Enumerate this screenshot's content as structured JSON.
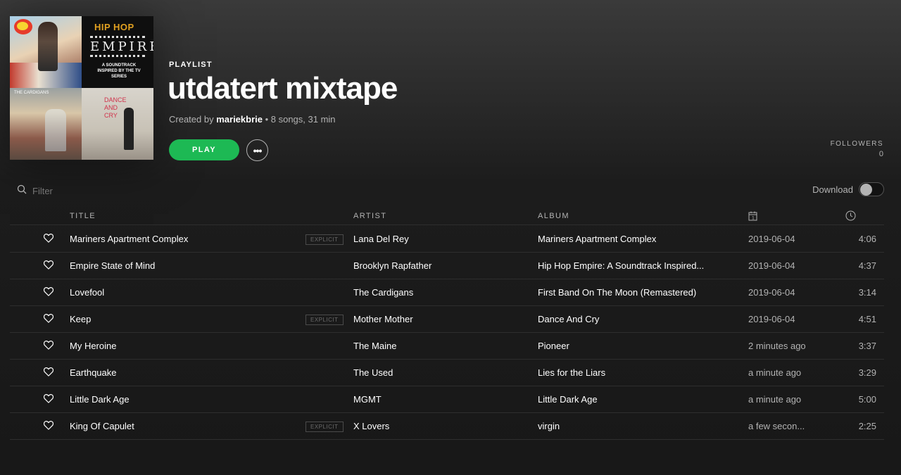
{
  "header": {
    "type_label": "PLAYLIST",
    "title": "utdatert mixtape",
    "created_by_prefix": "Created by",
    "owner": "mariekbrie",
    "summary": " • 8 songs, 31 min",
    "play_label": "PLAY",
    "more_label": "•••",
    "followers_label": "FOLLOWERS",
    "followers_count": "0",
    "cover_texts": {
      "hip_hop": "HIP HOP",
      "empire": "EMPIRE",
      "empire_sub": "A SOUNDTRACK INSPIRED BY THE TV SERIES",
      "cardigans": "THE CARDIGANS",
      "dance_and_cry": "DANCE AND CRY"
    }
  },
  "filter": {
    "placeholder": "Filter",
    "download_label": "Download",
    "download_on": false
  },
  "columns": {
    "title": "TITLE",
    "artist": "ARTIST",
    "album": "ALBUM",
    "date_icon": "calendar-icon",
    "duration_icon": "clock-icon"
  },
  "tracks": [
    {
      "title": "Mariners Apartment Complex",
      "explicit": "EXPLICIT",
      "artist": "Lana Del Rey",
      "album": "Mariners Apartment Complex",
      "added": "2019-06-04",
      "duration": "4:06"
    },
    {
      "title": "Empire State of Mind",
      "explicit": "",
      "artist": "Brooklyn Rapfather",
      "album": "Hip Hop Empire: A Soundtrack Inspired...",
      "added": "2019-06-04",
      "duration": "4:37"
    },
    {
      "title": "Lovefool",
      "explicit": "",
      "artist": "The Cardigans",
      "album": "First Band On The Moon (Remastered)",
      "added": "2019-06-04",
      "duration": "3:14"
    },
    {
      "title": "Keep",
      "explicit": "EXPLICIT",
      "artist": "Mother Mother",
      "album": "Dance And Cry",
      "added": "2019-06-04",
      "duration": "4:51"
    },
    {
      "title": "My Heroine",
      "explicit": "",
      "artist": "The Maine",
      "album": "Pioneer",
      "added": "2 minutes ago",
      "duration": "3:37"
    },
    {
      "title": "Earthquake",
      "explicit": "",
      "artist": "The Used",
      "album": "Lies for the Liars",
      "added": "a minute ago",
      "duration": "3:29"
    },
    {
      "title": "Little Dark Age",
      "explicit": "",
      "artist": "MGMT",
      "album": "Little Dark Age",
      "added": "a minute ago",
      "duration": "5:00"
    },
    {
      "title": "King Of Capulet",
      "explicit": "EXPLICIT",
      "artist": "X Lovers",
      "album": "virgin",
      "added": "a few secon...",
      "duration": "2:25"
    }
  ],
  "colors": {
    "accent": "#1db954",
    "text_primary": "#ffffff",
    "text_secondary": "#b3b3b3"
  }
}
